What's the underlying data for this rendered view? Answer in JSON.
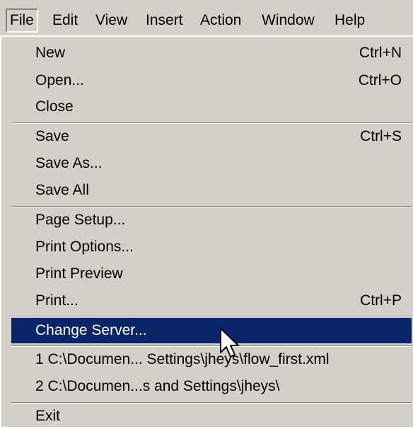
{
  "menubar": {
    "items": [
      {
        "label": "File"
      },
      {
        "label": "Edit"
      },
      {
        "label": "View"
      },
      {
        "label": "Insert"
      },
      {
        "label": "Action"
      },
      {
        "label": "Window"
      },
      {
        "label": "Help"
      }
    ]
  },
  "file_menu": {
    "items": [
      {
        "label": "New",
        "shortcut": "Ctrl+N"
      },
      {
        "label": "Open...",
        "shortcut": "Ctrl+O"
      },
      {
        "label": "Close"
      },
      {
        "label": "Save",
        "shortcut": "Ctrl+S"
      },
      {
        "label": "Save As..."
      },
      {
        "label": "Save All"
      },
      {
        "label": "Page Setup..."
      },
      {
        "label": "Print Options..."
      },
      {
        "label": "Print Preview"
      },
      {
        "label": "Print...",
        "shortcut": "Ctrl+P"
      },
      {
        "label": "Change Server..."
      },
      {
        "label": "1 C:\\Documen... Settings\\jheys\\flow_first.xml"
      },
      {
        "label": "2 C:\\Documen...s and Settings\\jheys\\"
      },
      {
        "label": "Exit"
      }
    ]
  },
  "colors": {
    "menu_background": "#d4d0c8",
    "highlight": "#0a246a",
    "highlight_text": "#ffffff"
  },
  "icons": {
    "cursor": "arrow-cursor-icon"
  }
}
